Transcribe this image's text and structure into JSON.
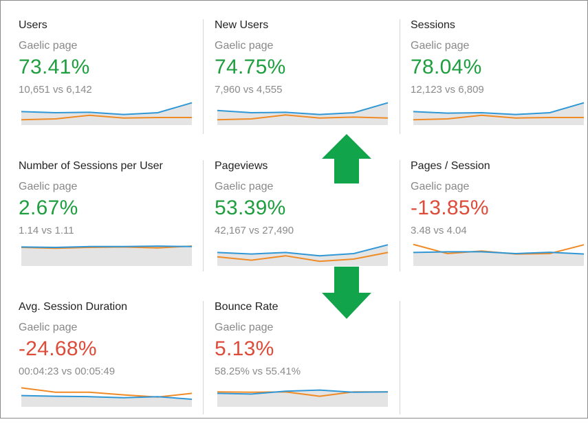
{
  "colors": {
    "positive": "#1e9e3e",
    "negative": "#dd4b39",
    "series_current": "#2f97d6",
    "series_previous": "#f08a24",
    "area": "#e4e4e4",
    "arrow": "#12a44a"
  },
  "cards": [
    {
      "title": "Users",
      "segment": "Gaelic page",
      "change": "73.41%",
      "trend": "positive",
      "comparison": "10,651 vs 6,142",
      "current": [
        0.55,
        0.5,
        0.52,
        0.42,
        0.5,
        0.95
      ],
      "previous": [
        0.18,
        0.22,
        0.38,
        0.26,
        0.28,
        0.28
      ]
    },
    {
      "title": "New Users",
      "segment": "Gaelic page",
      "change": "74.75%",
      "trend": "positive",
      "comparison": "7,960 vs 4,555",
      "current": [
        0.6,
        0.5,
        0.52,
        0.42,
        0.5,
        0.95
      ],
      "previous": [
        0.18,
        0.22,
        0.4,
        0.26,
        0.3,
        0.26
      ]
    },
    {
      "title": "Sessions",
      "segment": "Gaelic page",
      "change": "78.04%",
      "trend": "positive",
      "comparison": "12,123 vs 6,809",
      "current": [
        0.55,
        0.48,
        0.5,
        0.42,
        0.5,
        0.95
      ],
      "previous": [
        0.18,
        0.22,
        0.38,
        0.26,
        0.28,
        0.28
      ]
    },
    {
      "title": "Number of Sessions per User",
      "segment": "Gaelic page",
      "change": "2.67%",
      "trend": "positive",
      "comparison": "1.14 vs 1.11",
      "current": [
        0.8,
        0.78,
        0.82,
        0.82,
        0.84,
        0.82
      ],
      "previous": [
        0.78,
        0.74,
        0.78,
        0.8,
        0.76,
        0.84
      ]
    },
    {
      "title": "Pageviews",
      "segment": "Gaelic page",
      "change": "53.39%",
      "trend": "positive",
      "comparison": "42,167 vs 27,490",
      "current": [
        0.55,
        0.48,
        0.55,
        0.4,
        0.5,
        0.9
      ],
      "previous": [
        0.35,
        0.2,
        0.4,
        0.15,
        0.25,
        0.55
      ]
    },
    {
      "title": "Pages / Session",
      "segment": "Gaelic page",
      "change": "-13.85%",
      "trend": "negative",
      "comparison": "3.48 vs 4.04",
      "current": [
        0.55,
        0.58,
        0.58,
        0.5,
        0.56,
        0.48
      ],
      "previous": [
        0.92,
        0.5,
        0.62,
        0.48,
        0.5,
        0.9
      ]
    },
    {
      "title": "Avg. Session Duration",
      "segment": "Gaelic page",
      "change": "-24.68%",
      "trend": "negative",
      "comparison": "00:04:23 vs 00:05:49",
      "current": [
        0.45,
        0.42,
        0.4,
        0.35,
        0.4,
        0.28
      ],
      "previous": [
        0.8,
        0.6,
        0.6,
        0.48,
        0.38,
        0.55
      ]
    },
    {
      "title": "Bounce Rate",
      "segment": "Gaelic page",
      "change": "5.13%",
      "trend": "negative",
      "comparison": "58.25% vs 55.41%",
      "current": [
        0.55,
        0.52,
        0.65,
        0.7,
        0.6,
        0.62
      ],
      "previous": [
        0.62,
        0.6,
        0.62,
        0.42,
        0.62,
        0.62
      ]
    }
  ]
}
